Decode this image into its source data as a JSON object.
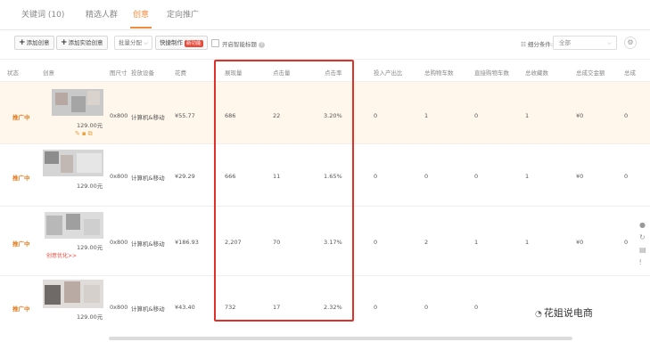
{
  "tabs": [
    {
      "label": "关键词 (10)"
    },
    {
      "label": "精选人群"
    },
    {
      "label": "创意"
    },
    {
      "label": "定向推广"
    }
  ],
  "toolbar": {
    "add_creative": "添加创意",
    "add_test_creative": "添加实验创意",
    "batch_select": "批量分配",
    "quick_make": "快捷制作",
    "new_badge": "新功能",
    "smart_title": "开启智能标题",
    "segment_label": "细分条件:",
    "segment_value": "全部"
  },
  "columns": [
    "状态",
    "创意",
    "图尺寸",
    "投放设备",
    "花费",
    "展现量",
    "点击量",
    "点击率",
    "投入产出比",
    "总购物车数",
    "直接购物车数",
    "总收藏数",
    "总成交金额",
    "总成"
  ],
  "rows": [
    {
      "status": "推广中",
      "price": "129.00元",
      "size": "0x800",
      "device": "计算机&移动",
      "cost": "¥55.77",
      "impressions": "686",
      "clicks": "22",
      "ctr": "3.20%",
      "roi": "0",
      "cart_total": "1",
      "cart_direct": "0",
      "fav": "1",
      "gmv": "¥0",
      "last": "0"
    },
    {
      "status": "推广中",
      "price": "129.00元",
      "size": "0x800",
      "device": "计算机&移动",
      "cost": "¥29.29",
      "impressions": "666",
      "clicks": "11",
      "ctr": "1.65%",
      "roi": "0",
      "cart_total": "0",
      "cart_direct": "0",
      "fav": "1",
      "gmv": "¥0",
      "last": "0"
    },
    {
      "status": "推广中",
      "price": "129.00元",
      "size": "0x800",
      "device": "计算机&移动",
      "cost": "¥186.93",
      "impressions": "2,207",
      "clicks": "70",
      "ctr": "3.17%",
      "roi": "0",
      "cart_total": "2",
      "cart_direct": "1",
      "fav": "1",
      "gmv": "¥0",
      "last": "0",
      "link": "创意优化>>"
    },
    {
      "status": "推广中",
      "price": "129.00元",
      "size": "0x800",
      "device": "计算机&移动",
      "cost": "¥43.40",
      "impressions": "732",
      "clicks": "17",
      "ctr": "2.32%",
      "roi": "0",
      "cart_total": "0",
      "cart_direct": "0",
      "fav": "",
      "gmv": "",
      "last": ""
    }
  ],
  "watermark": "花姐说电商",
  "colors": {
    "accent": "#f08a3c",
    "highlight_row": "#fff6ec",
    "red_box": "#e0302a"
  }
}
